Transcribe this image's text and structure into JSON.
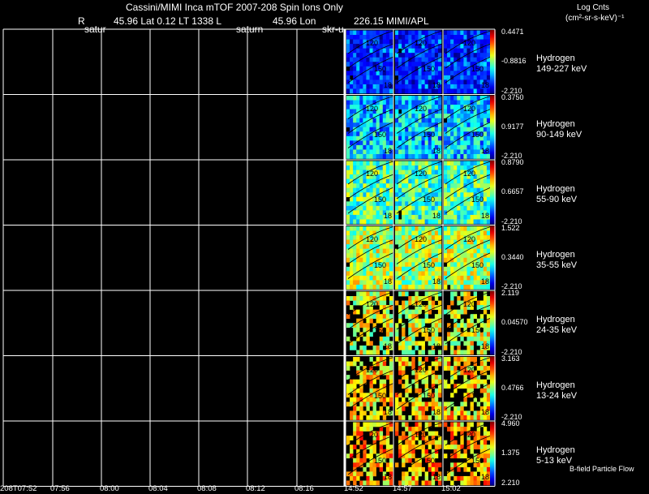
{
  "header": {
    "title": "Cassini/MIMI Inca mTOF  2007-208   Spin   Ions Only",
    "info_line_left": "R",
    "info_line_mid": "45.96 Lat 0.12 LT 1338 L",
    "info_line_lon": "45.96 Lon",
    "info_line_right": "226.15  MIMI/APL",
    "sub_labels": [
      "satur",
      "saturn",
      "skr-u"
    ],
    "units_title": "Log Cnts",
    "units_sub": "(cm²-sr-s-keV)⁻¹"
  },
  "x_ticks": [
    "208T07:52",
    "07:56",
    "08:00",
    "08:04",
    "08:08",
    "08:12",
    "08:16",
    "14:52",
    "14:57",
    "15:02"
  ],
  "footer_note": "B-field Particle Flow",
  "chart_data": {
    "type": "heatmap",
    "description_labels": "Energy channels for hydrogen ions; each row shows a color-scaled sky map with contour labels",
    "contour_labels": [
      "120",
      "150",
      "18",
      "90"
    ],
    "rows": [
      {
        "species": "Hydrogen",
        "energy": "149-227 keV",
        "cbar_max": "0.4471",
        "cbar_mid": "-0.8816",
        "cbar_min": "-2.210"
      },
      {
        "species": "Hydrogen",
        "energy": "90-149 keV",
        "cbar_max": "0.3750",
        "cbar_mid": "0.9177",
        "cbar_min": "-2.210"
      },
      {
        "species": "Hydrogen",
        "energy": "55-90 keV",
        "cbar_max": "0.8790",
        "cbar_mid": "0.6657",
        "cbar_min": "-2.210"
      },
      {
        "species": "Hydrogen",
        "energy": "35-55 keV",
        "cbar_max": "1.522",
        "cbar_mid": "0.3440",
        "cbar_min": "-2.210"
      },
      {
        "species": "Hydrogen",
        "energy": "24-35 keV",
        "cbar_max": "2.119",
        "cbar_mid": "0.04570",
        "cbar_min": "-2.210"
      },
      {
        "species": "Hydrogen",
        "energy": "13-24 keV",
        "cbar_max": "3.163",
        "cbar_mid": "0.4766",
        "cbar_min": "-2.210"
      },
      {
        "species": "Hydrogen",
        "energy": "5-13 keV",
        "cbar_max": "4.960",
        "cbar_mid": "1.375",
        "cbar_min": "2.210"
      }
    ]
  }
}
